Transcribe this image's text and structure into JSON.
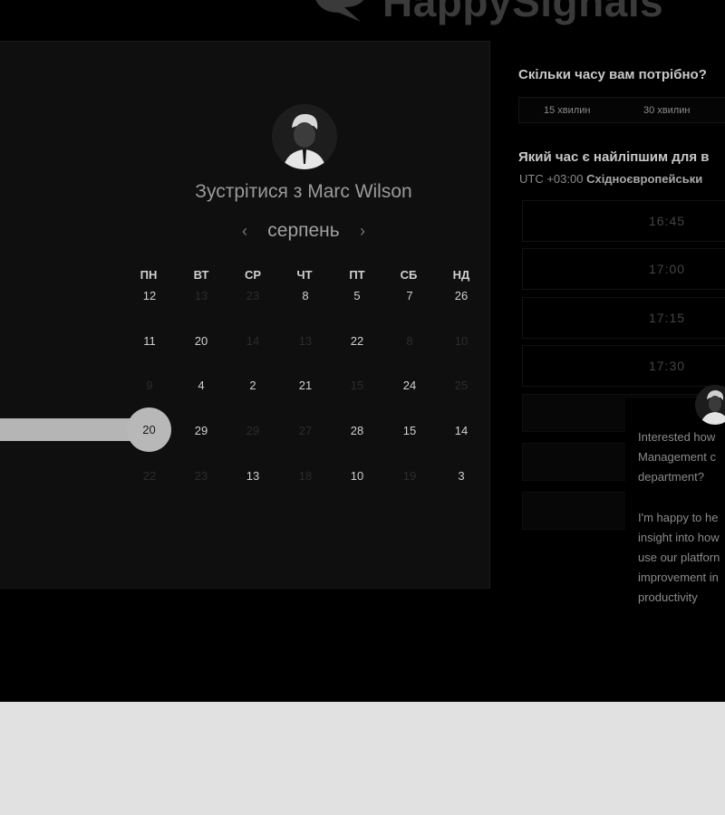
{
  "header": {
    "logo_text": "HappySignals"
  },
  "calendar": {
    "title": "Зустрітися з Marc Wilson",
    "month": "серпень",
    "prev_icon": "‹",
    "next_icon": "›",
    "weekdays": [
      "ПН",
      "ВТ",
      "СР",
      "ЧТ",
      "ПТ",
      "СБ",
      "НД"
    ],
    "weeks": [
      [
        "12",
        "13",
        "23",
        "8",
        "5",
        "7",
        "26"
      ],
      [
        "11",
        "20",
        "14",
        "13",
        "22",
        "8",
        "10"
      ],
      [
        "9",
        "4",
        "2",
        "21",
        "15",
        "24",
        "25"
      ],
      [
        "20",
        "29",
        "29",
        "27",
        "28",
        "15",
        "14"
      ],
      [
        "22",
        "23",
        "13",
        "18",
        "10",
        "19",
        "3"
      ]
    ],
    "selected_day": "20"
  },
  "duration": {
    "question": "Скільки часу вам потрібно?",
    "options": [
      "15 хвилин",
      "30 хвилин"
    ]
  },
  "times": {
    "question": "Який час є найліпшим для в",
    "timezone_offset": "UTC +03:00",
    "timezone_name": "Східноєвропейськи",
    "slots": [
      "16:45",
      "17:00",
      "17:15",
      "17:30"
    ]
  },
  "chat": {
    "lines": [
      "Interested how",
      "Management c",
      "department?",
      "I'm happy to he",
      "insight into how",
      "use our platforn",
      "improvement in",
      "productivity"
    ]
  },
  "colors": {
    "page_bg": "#000000",
    "card_bg": "#0f0f0f",
    "footer_bg": "#e1e1e1",
    "accent": "#b8b8b8"
  }
}
